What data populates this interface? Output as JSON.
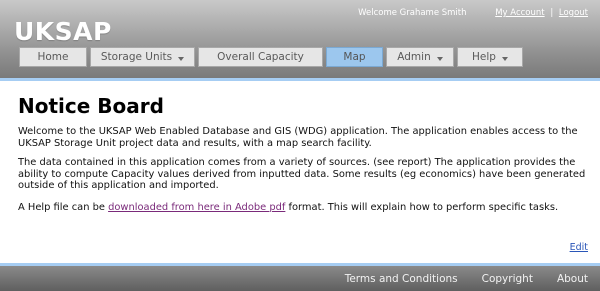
{
  "brand": "UKSAP",
  "user": {
    "welcome": "Welcome Grahame Smith",
    "my_account": "My Account",
    "separator": "|",
    "logout": "Logout"
  },
  "nav": [
    {
      "label": "Home",
      "dropdown": false
    },
    {
      "label": "Storage Units",
      "dropdown": true
    },
    {
      "label": "Overall Capacity",
      "dropdown": false
    },
    {
      "label": "Map",
      "dropdown": false,
      "active": true
    },
    {
      "label": "Admin",
      "dropdown": true
    },
    {
      "label": "Help",
      "dropdown": true
    }
  ],
  "notice": {
    "title": "Notice Board",
    "p1": "Welcome to the UKSAP Web Enabled Database and GIS (WDG) application. The application enables access to the UKSAP Storage Unit project data and results, with a map search facility.",
    "p2": "The data contained in this application comes from a variety of sources. (see report) The application provides the ability to compute Capacity values derived from inputted data. Some results (eg economics) have been generated outside of this application and imported.",
    "p3_before": "A Help file can be ",
    "p3_link": "downloaded from here in Adobe pdf",
    "p3_after": " format. This will explain how to perform specific tasks.",
    "edit": "Edit"
  },
  "footer": {
    "terms": "Terms and Conditions",
    "copyright": "Copyright",
    "about": "About"
  },
  "colors": {
    "active_tab": "#9cc7ee",
    "accent_rule": "#a6cdf3",
    "visited_link": "#7a2a7a",
    "link": "#2a56b8"
  }
}
